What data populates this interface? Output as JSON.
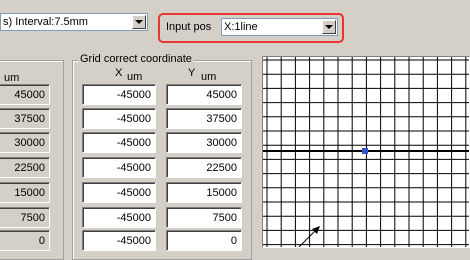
{
  "top": {
    "interval_combo_text": "s) Interval:7.5mm",
    "input_pos_label": "Input pos",
    "input_pos_value": "X:1line"
  },
  "left_group": {
    "header": "um",
    "values": [
      "45000",
      "37500",
      "30000",
      "22500",
      "15000",
      "7500",
      "0"
    ]
  },
  "grid_group": {
    "title": "Grid correct coordinate",
    "x_header": "X",
    "x_unit": "um",
    "y_header": "Y",
    "y_unit": "um",
    "rows": [
      {
        "x": "-45000",
        "y": "45000"
      },
      {
        "x": "-45000",
        "y": "37500"
      },
      {
        "x": "-45000",
        "y": "30000"
      },
      {
        "x": "-45000",
        "y": "22500"
      },
      {
        "x": "-45000",
        "y": "15000"
      },
      {
        "x": "-45000",
        "y": "7500"
      },
      {
        "x": "-45000",
        "y": "0"
      }
    ]
  },
  "colors": {
    "highlight": "#e8352e",
    "grid_line": "#000000",
    "marker": "#3355cc"
  }
}
